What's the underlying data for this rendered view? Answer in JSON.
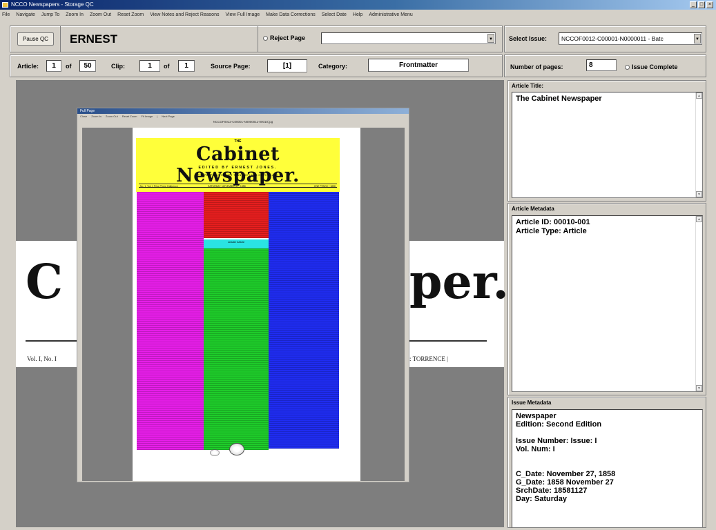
{
  "window": {
    "title": "NCCO Newspapers - Storage QC",
    "buttons": [
      "_",
      "□",
      "×"
    ]
  },
  "menu": [
    "File",
    "Navigate",
    "Jump To",
    "Zoom In",
    "Zoom Out",
    "Reset Zoom",
    "View Notes and Reject Reasons",
    "View Full Image",
    "Make Data Corrections",
    "Select Date",
    "Help",
    "Administrative Menu"
  ],
  "toolbar": {
    "pause_label": "Pause QC",
    "user": "ERNEST",
    "reject_label": "Reject Page",
    "reject_value": "",
    "select_issue_label": "Select Issue:",
    "select_issue_value": "NCCOF0012-C00001-N0000011 - Batc"
  },
  "nav": {
    "article_label": "Article:",
    "article_num": "1",
    "of_label": "of",
    "article_total": "50",
    "clip_label": "Clip:",
    "clip_num": "1",
    "clip_total": "1",
    "source_label": "Source Page:",
    "source_value": "[1]",
    "category_label": "Category:",
    "category_value": "Frontmatter",
    "pages_label": "Number of pages:",
    "pages_value": "8",
    "complete_label": "Issue Complete"
  },
  "viewer": {
    "left_text": "C",
    "right_text": "per.",
    "left_small": "Vol. I, No. I",
    "right_small": ": TORRENCE | "
  },
  "full_page": {
    "title": "Full Page",
    "menu": [
      "Close",
      "Zoom In",
      "Zoom Out",
      "Reset Zoom",
      "Fit Image",
      "|",
      "Next Page"
    ],
    "filename": "NCCOF0012-C00001-N0000011-00010.jpg",
    "the": "THE",
    "title_text": "Cabinet Newspaper.",
    "subtitle": "EDITED BY ERNEST JONES.",
    "tagline": "THE PEOPLE IS HIGHER THAN THE LAWS OF THE LAND",
    "bar_left": "No. 1, Vol. I. Price Three Halfpence",
    "bar_mid": "SATURDAY, NOVEMBER 27, 1858",
    "bar_right": "ONE PENNY / 1858",
    "cyan_label": "Leader Article",
    "colors": {
      "masthead": "#ffff3a",
      "left_col": "#e61ee8",
      "top_center": "#e51e1e",
      "cyan": "#2ae3e3",
      "center": "#1ecb2a",
      "right_col": "#1f2cf0"
    }
  },
  "article_title": {
    "heading": "Article Title:",
    "value": "The Cabinet Newspaper"
  },
  "article_metadata": {
    "heading": "Article Metadata",
    "lines": [
      "Article ID: 00010-001",
      "Article Type: Article"
    ]
  },
  "issue_metadata": {
    "heading": "Issue Metadata",
    "lines": [
      "Newspaper",
      "Edition: Second Edition",
      "",
      "Issue Number: Issue: I",
      "Vol. Num: I",
      "",
      "",
      "C_Date: November 27, 1858",
      "G_Date: 1858 November 27",
      "SrchDate: 18581127",
      "Day: Saturday"
    ]
  }
}
